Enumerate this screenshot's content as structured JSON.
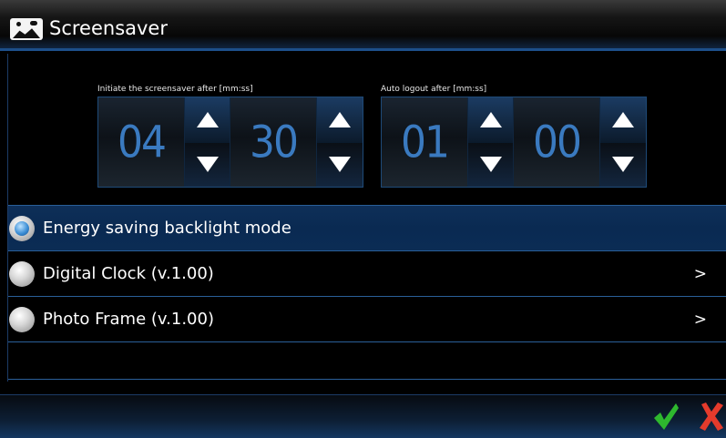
{
  "window": {
    "title": "Screensaver",
    "icon": "picture-icon"
  },
  "timers": [
    {
      "label": "Initiate the screensaver after [mm:ss]",
      "minutes": "04",
      "seconds": "30"
    },
    {
      "label": "Auto logout after [mm:ss]",
      "minutes": "01",
      "seconds": "00"
    }
  ],
  "options": [
    {
      "label": "Energy saving backlight mode",
      "selected": true,
      "chevron": ""
    },
    {
      "label": "Digital Clock (v.1.00)",
      "selected": false,
      "chevron": ">"
    },
    {
      "label": "Photo Frame (v.1.00)",
      "selected": false,
      "chevron": ">"
    }
  ],
  "footer": {
    "ok_icon": "checkmark-icon",
    "cancel_icon": "x-icon"
  },
  "colors": {
    "accent": "#1d4f8a",
    "selected_row": "#0b2c55",
    "ok": "#2eb82e",
    "cancel": "#e53b2c",
    "digit": "#3a7ac0"
  }
}
